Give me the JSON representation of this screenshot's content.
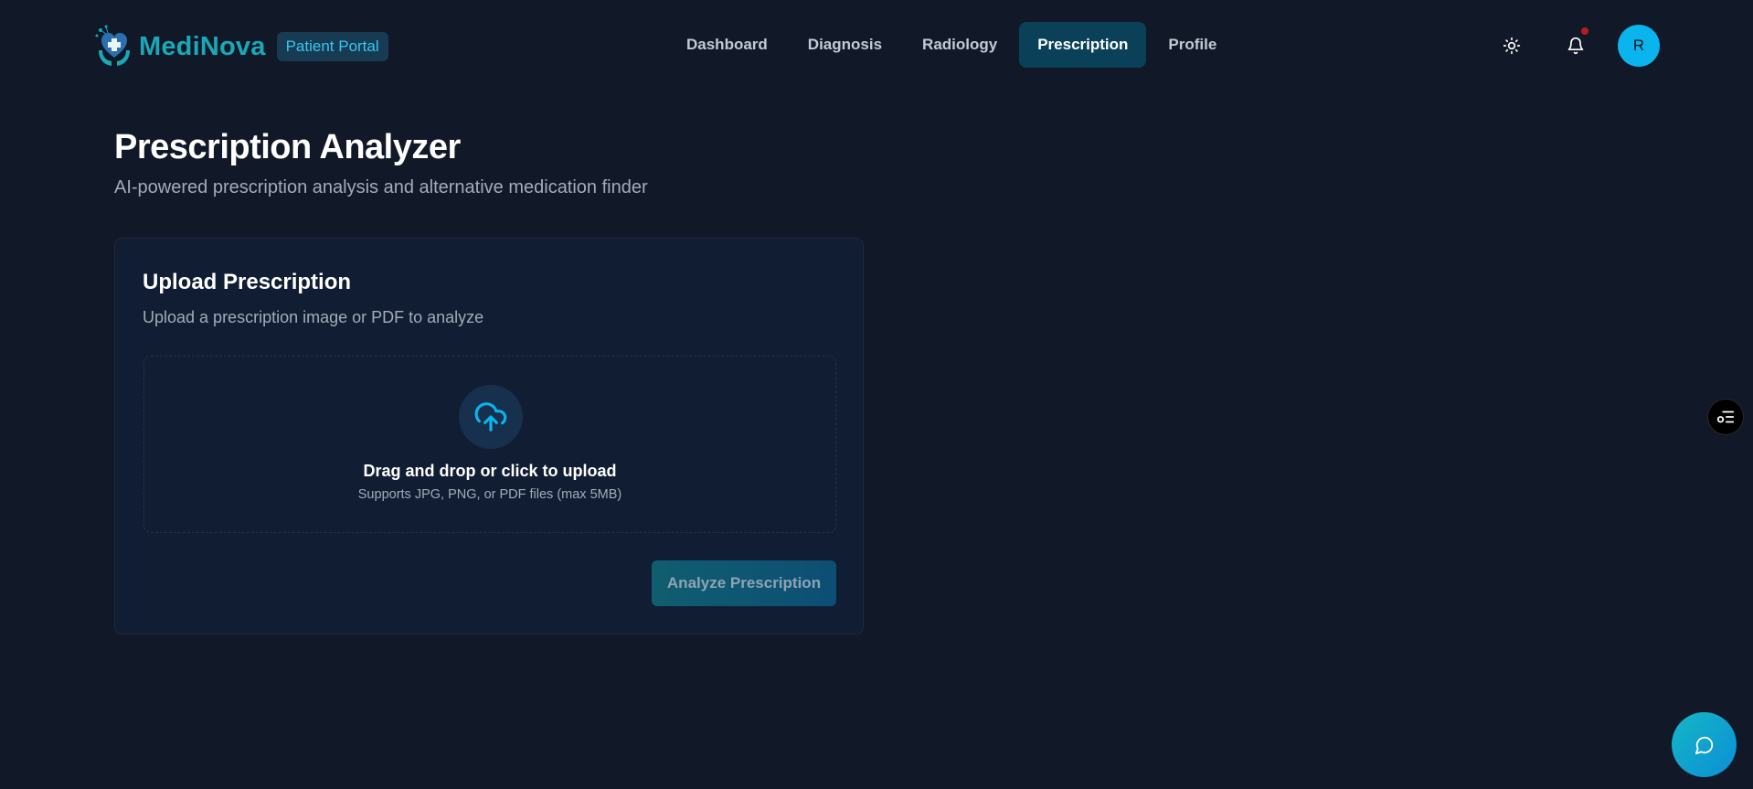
{
  "header": {
    "brand": "MediNova",
    "portal_badge": "Patient Portal",
    "nav": [
      {
        "label": "Dashboard",
        "active": false
      },
      {
        "label": "Diagnosis",
        "active": false
      },
      {
        "label": "Radiology",
        "active": false
      },
      {
        "label": "Prescription",
        "active": true
      },
      {
        "label": "Profile",
        "active": false
      }
    ],
    "theme_icon": "sun-icon",
    "notification_icon": "bell-icon",
    "has_unread_notifications": true,
    "avatar_initial": "R"
  },
  "main": {
    "title": "Prescription Analyzer",
    "subtitle": "AI-powered prescription analysis and alternative medication finder"
  },
  "upload_card": {
    "title": "Upload Prescription",
    "description": "Upload a prescription image or PDF to analyze",
    "dropzone": {
      "icon": "cloud-upload-icon",
      "title": "Drag and drop or click to upload",
      "subtitle": "Supports JPG, PNG, or PDF files (max 5MB)"
    },
    "analyze_button": "Analyze Prescription",
    "analyze_button_disabled": true
  },
  "floating": {
    "side_button_icon": "filter-list-icon",
    "chat_button_icon": "chat-bubble-icon"
  },
  "colors": {
    "background": "#111827",
    "card": "#111d33",
    "brand": "#1aa8b6",
    "accent": "#0ab4ec",
    "active_nav": "#0a4159",
    "notification_dot": "#b91c1c"
  }
}
